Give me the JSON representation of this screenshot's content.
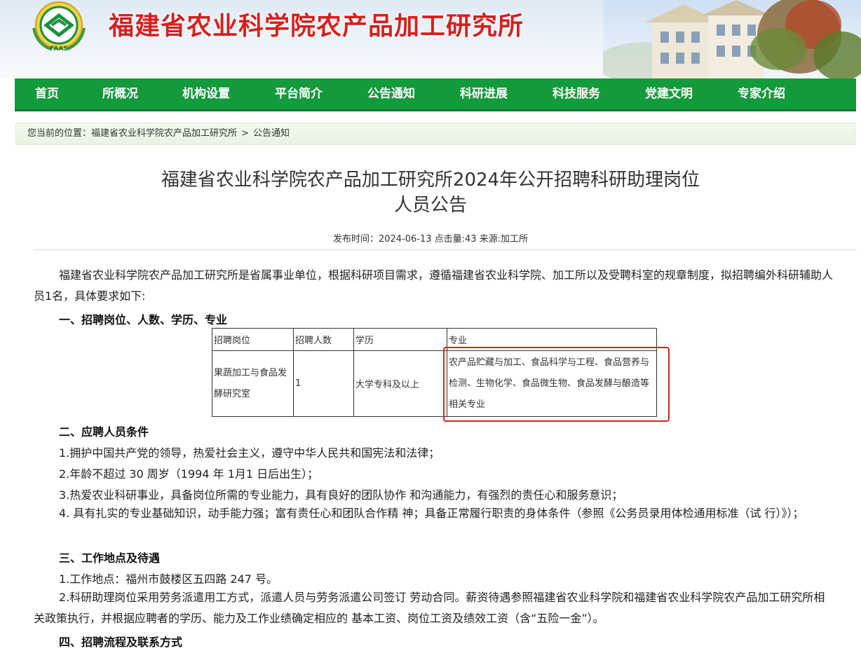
{
  "header": {
    "site_title": "福建省农业科学院农产品加工研究所",
    "logo_text": "FAAS"
  },
  "nav": {
    "items": [
      {
        "label": "首页"
      },
      {
        "label": "所概况"
      },
      {
        "label": "机构设置"
      },
      {
        "label": "平台简介"
      },
      {
        "label": "公告通知"
      },
      {
        "label": "科研进展"
      },
      {
        "label": "科技服务"
      },
      {
        "label": "党建文明"
      },
      {
        "label": "专家介绍"
      }
    ]
  },
  "breadcrumb": {
    "prefix": "您当前的位置：",
    "items": [
      "福建省农业科学院农产品加工研究所",
      "公告通知"
    ],
    "separator": ">"
  },
  "article": {
    "title_line1": "福建省农业科学院农产品加工研究所2024年公开招聘科研助理岗位",
    "title_line2": "人员公告",
    "meta": "发布时间：2024-06-13   点击量:43   来源:加工所",
    "intro": "福建省农业科学院农产品加工研究所是省属事业单位，根据科研项目需求，遵循福建省农业科学院、加工所以及受聘科室的规章制度，拟招聘编外科研辅助人员1名，具体要求如下:",
    "section1": "一、招聘岗位、人数、学历、专业",
    "table": {
      "headers": [
        "招聘岗位",
        "招聘人数",
        "学历",
        "专业"
      ],
      "row": {
        "post": "果蔬加工与食品发酵研究室",
        "count": "1",
        "education": "大学专科及以上",
        "major": "农产品贮藏与加工、食品科学与工程、食品营养与检测、生物化学、食品微生物、食品发酵与酿造等相关专业"
      }
    },
    "section2": "二、应聘人员条件",
    "cond1": "1.拥护中国共产党的领导，热爱社会主义，遵守中华人民共和国宪法和法律；",
    "cond2": "2.年龄不超过 30 周岁（1994 年 1月1 日后出生）；",
    "cond3": "3.热爱农业科研事业，具备岗位所需的专业能力，具有良好的团队协作 和沟通能力，有强烈的责任心和服务意识；",
    "cond4": "4. 具有扎实的专业基础知识，动手能力强；富有责任心和团队合作精 神；具备正常履行职责的身体条件（参照《公务员录用体检通用标准（试 行）》）；",
    "section3": "三、工作地点及待遇",
    "work1": "1.工作地点：福州市鼓楼区五四路 247 号。",
    "work2": "2.科研助理岗位采用劳务派遣用工方式，派遣人员与劳务派遣公司签订 劳动合同。薪资待遇参照福建省农业科学院和福建省农业科学院农产品加工研究所相关政策执行，并根据应聘者的学历、能力及工作业绩确定相应的 基本工资、岗位工资及绩效工资（含“五险一金”）。",
    "section4": "四、招聘流程及联系方式"
  },
  "colors": {
    "nav_green": "#139a3a",
    "title_red": "#d81e1e",
    "highlight_red": "#e02020"
  }
}
